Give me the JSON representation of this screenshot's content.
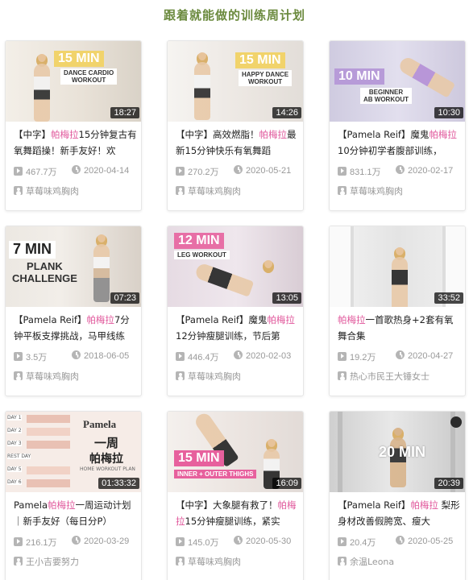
{
  "heading": "跟着就能做的训练周计划",
  "cards": [
    {
      "thumb_big": "15 MIN",
      "thumb_sub": "DANCE CARDIO\nWORKOUT",
      "duration": "18:27",
      "title_pre": "【中字】",
      "title_hl": "帕梅拉",
      "title_post": "15分钟复古有氧舞蹈操！新手友好！欢",
      "views": "467.7万",
      "date": "2020-04-14",
      "author": "草莓味鸡胸肉",
      "colors": {
        "badge": "#f1d36b",
        "bg": "#ece7df"
      }
    },
    {
      "thumb_big": "15 MIN",
      "thumb_sub": "HAPPY DANCE\nWORKOUT",
      "duration": "14:26",
      "title_pre": "【中字】高效燃脂！",
      "title_hl": "帕梅拉",
      "title_post": "最新15分钟快乐有氧舞蹈",
      "views": "270.2万",
      "date": "2020-05-21",
      "author": "草莓味鸡胸肉",
      "colors": {
        "badge": "#f1d36b",
        "bg": "#eeeae6"
      }
    },
    {
      "thumb_big": "10 MIN",
      "thumb_sub": "BEGINNER\nAB WORKOUT",
      "duration": "10:30",
      "title_pre": "【Pamela Reif】魔鬼",
      "title_hl": "帕梅拉",
      "title_post": "10分钟初学者腹部训练，",
      "views": "831.1万",
      "date": "2020-02-17",
      "author": "草莓味鸡胸肉",
      "colors": {
        "badge": "#b79bd8",
        "bg": "#d6d3e6"
      }
    },
    {
      "thumb_big": "7 MIN",
      "thumb_sub": "PLANK\nCHALLENGE",
      "duration": "07:23",
      "title_pre": "【Pamela Reif】",
      "title_hl": "帕梅拉",
      "title_post": "7分钟平板支撑挑战，马甲线练",
      "views": "3.5万",
      "date": "2018-06-05",
      "author": "草莓味鸡胸肉",
      "colors": {
        "badge": "#ffffff",
        "bg": "#e9e3dc"
      }
    },
    {
      "thumb_big": "12 MIN",
      "thumb_sub": "LEG WORKOUT",
      "duration": "13:05",
      "title_pre": "【Pamela Reif】魔鬼",
      "title_hl": "帕梅拉",
      "title_post": "12分钟瘦腿训练，节后第",
      "views": "446.4万",
      "date": "2020-02-03",
      "author": "草莓味鸡胸肉",
      "colors": {
        "badge": "#e76fa6",
        "bg": "#e3d8e2"
      }
    },
    {
      "thumb_big": "",
      "thumb_sub": "",
      "duration": "33:52",
      "title_pre": "",
      "title_hl": "帕梅拉",
      "title_post": "一首歌热身+2套有氧舞合集",
      "views": "19.2万",
      "date": "2020-04-27",
      "author": "热心市民王大锤女士",
      "colors": {
        "badge": "#ffffff",
        "bg": "#e6e6e6"
      }
    },
    {
      "thumb_big": "一周",
      "thumb_sub": "帕梅拉",
      "thumb_brand": "Pamela",
      "thumb_plan": "HOME WORKOUT PLAN",
      "days": [
        "DAY 1",
        "DAY 2",
        "DAY 3",
        "REST DAY",
        "DAY 5",
        "DAY 6"
      ],
      "duration": "01:33:32",
      "title_pre": "Pamela",
      "title_hl": "帕梅拉",
      "title_post": "一周运动计划｜新手友好（每日分P）",
      "views": "216.1万",
      "date": "2020-03-29",
      "author": "王小吉要努力",
      "colors": {
        "badge": "#333333",
        "bg": "#f4e9e4"
      }
    },
    {
      "thumb_big": "15 MIN",
      "thumb_sub": "INNER + OUTER THIGHS",
      "duration": "16:09",
      "title_pre": "【中字】大象腿有救了！",
      "title_hl": "帕梅拉",
      "title_post": "15分钟瘦腿训练，紧实",
      "views": "145.0万",
      "date": "2020-05-30",
      "author": "草莓味鸡胸肉",
      "colors": {
        "badge": "#e7609d",
        "bg": "#efe9e6"
      }
    },
    {
      "thumb_big": "20 MIN",
      "thumb_sub": "",
      "duration": "20:39",
      "title_pre": "【Pamela Reif】",
      "title_hl": "帕梅拉",
      "title_post": " 梨形身材改善假胯宽、瘦大",
      "views": "20.4万",
      "date": "2020-05-25",
      "author": "余温Leona",
      "colors": {
        "badge": "#ffffff",
        "bg": "#dcdcdc"
      }
    }
  ]
}
